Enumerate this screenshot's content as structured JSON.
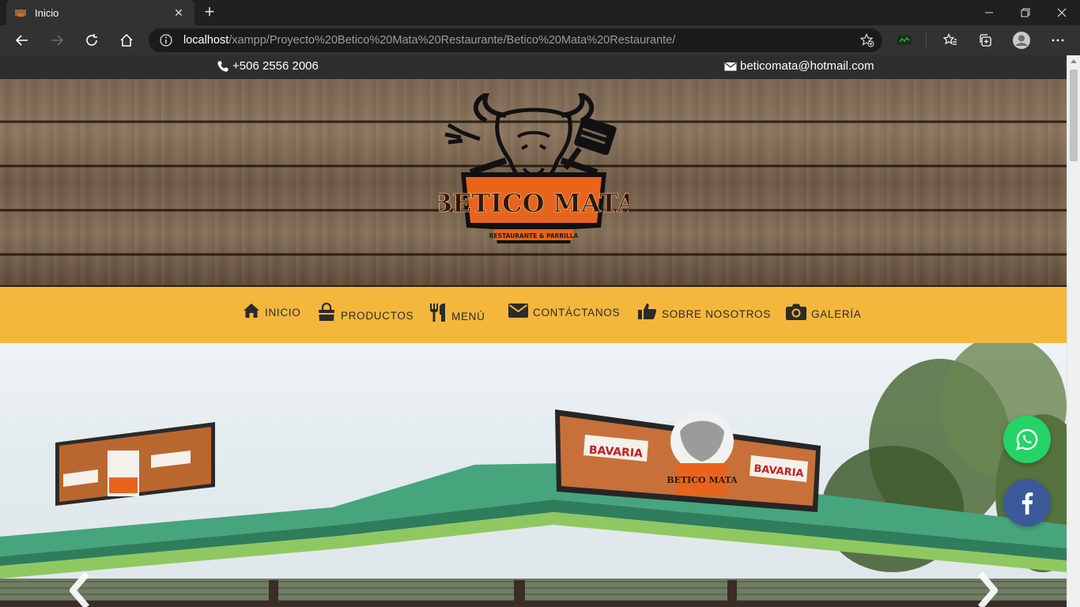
{
  "browser": {
    "tab_title": "Inicio",
    "tab_close": "✕",
    "new_tab": "+",
    "url_host": "localhost",
    "url_path": "/xampp/Proyecto%20Betico%20Mata%20Restaurante/Betico%20Mata%20Restaurante/"
  },
  "contact": {
    "phone": "+506 2556 2006",
    "email": "beticomata@hotmail.com"
  },
  "logo": {
    "name": "BETICO MATA",
    "tagline": "RESTAURANTE & PARRILLA"
  },
  "nav": [
    {
      "label": "INICIO",
      "icon": "home-icon"
    },
    {
      "label": "PRODUCTOS",
      "icon": "shopping-bag-icon"
    },
    {
      "label": "MENÚ",
      "icon": "cutlery-icon"
    },
    {
      "label": "CONTÁCTANOS",
      "icon": "envelope-icon"
    },
    {
      "label": "SOBRE NOSOTROS",
      "icon": "thumbs-up-icon"
    },
    {
      "label": "GALERÍA",
      "icon": "camera-icon"
    }
  ],
  "hero": {
    "sign_brand": "BAVARIA",
    "sign_logo": "BETICO MATA"
  },
  "social": [
    {
      "name": "whatsapp",
      "color": "#25d366"
    },
    {
      "name": "facebook",
      "color": "#3b5998"
    }
  ],
  "colors": {
    "menu_bar": "#f4b73c",
    "topbar": "#2e2e2e",
    "logo_orange": "#e8641c"
  }
}
